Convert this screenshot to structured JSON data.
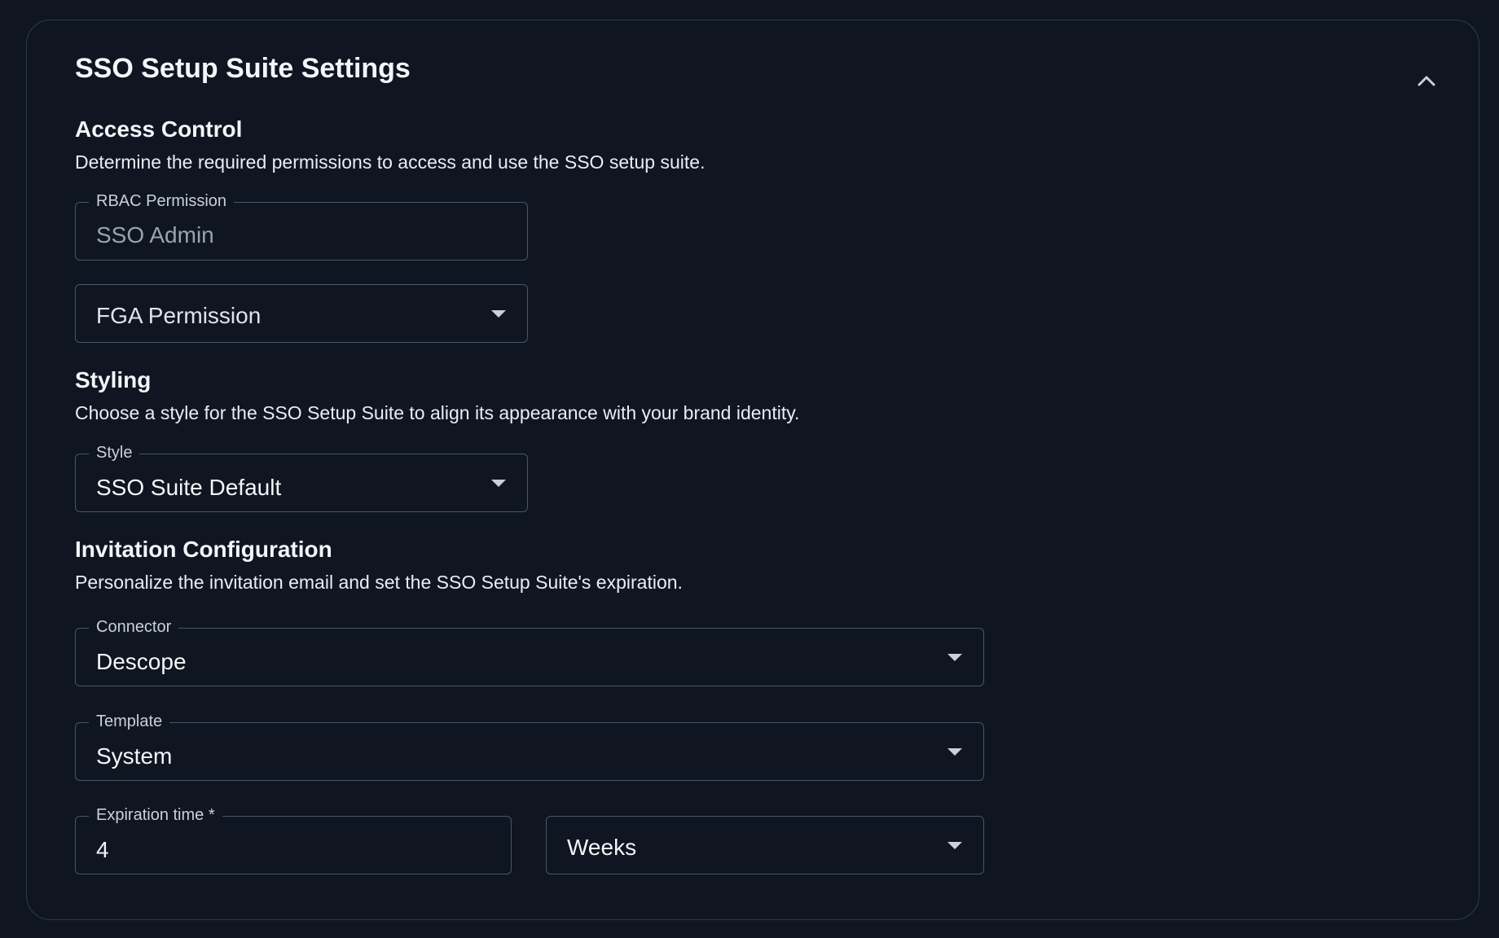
{
  "card": {
    "title": "SSO Setup Suite Settings",
    "collapse_icon": "chevron-up-icon"
  },
  "access_control": {
    "title": "Access Control",
    "description": "Determine the required permissions to access and use the SSO setup suite.",
    "rbac": {
      "label": "RBAC Permission",
      "value": "SSO Admin"
    },
    "fga": {
      "placeholder": "FGA Permission"
    }
  },
  "styling": {
    "title": "Styling",
    "description": "Choose a style for the SSO Setup Suite to align its appearance with your brand identity.",
    "style": {
      "label": "Style",
      "value": "SSO Suite Default"
    }
  },
  "invitation": {
    "title": "Invitation Configuration",
    "description": "Personalize the invitation email and set the SSO Setup Suite's expiration.",
    "connector": {
      "label": "Connector",
      "value": "Descope"
    },
    "template": {
      "label": "Template",
      "value": "System"
    },
    "expiration": {
      "label": "Expiration time *",
      "value": "4"
    },
    "unit": {
      "value": "Weeks"
    }
  },
  "colors": {
    "background": "#0f1621",
    "border": "#4b5566",
    "text": "#f3f5f8"
  }
}
